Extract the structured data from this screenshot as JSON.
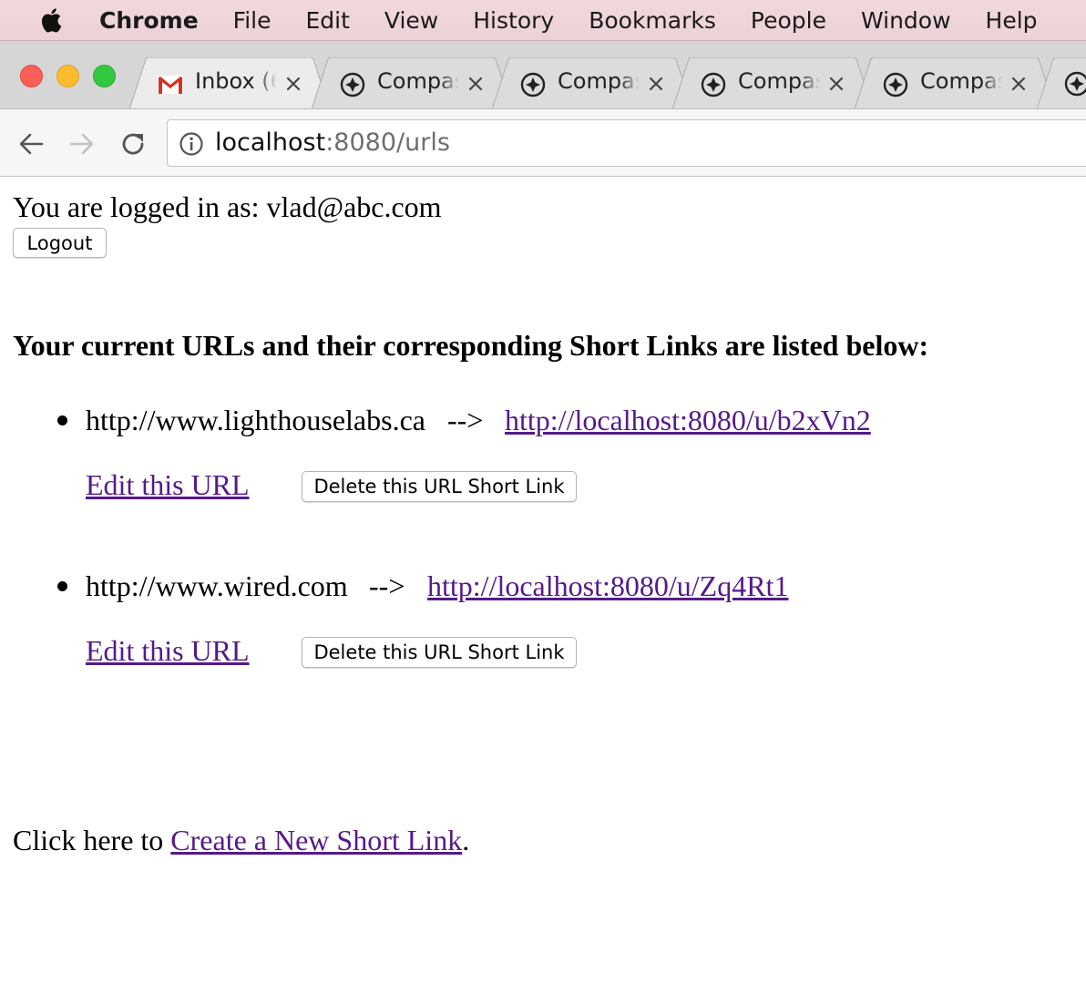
{
  "menubar": {
    "app_name": "Chrome",
    "items": [
      "File",
      "Edit",
      "View",
      "History",
      "Bookmarks",
      "People",
      "Window",
      "Help"
    ]
  },
  "tabs": [
    {
      "title": "Inbox (6",
      "icon": "gmail-icon"
    },
    {
      "title": "Compas",
      "icon": "compass-icon"
    },
    {
      "title": "Compas",
      "icon": "compass-icon"
    },
    {
      "title": "Compas",
      "icon": "compass-icon"
    },
    {
      "title": "Compas",
      "icon": "compass-icon"
    }
  ],
  "address_bar": {
    "host": "localhost",
    "rest": ":8080/urls"
  },
  "page": {
    "logged_in_text": "You are logged in as: vlad@abc.com",
    "logout_label": "Logout",
    "heading": "Your current URLs and their corresponding Short Links are listed below:",
    "arrow": "-->",
    "urls": [
      {
        "long_url": "http://www.lighthouselabs.ca",
        "short_url": "http://localhost:8080/u/b2xVn2",
        "edit_label": "Edit this URL",
        "delete_label": "Delete this URL Short Link"
      },
      {
        "long_url": "http://www.wired.com",
        "short_url": "http://localhost:8080/u/Zq4Rt1",
        "edit_label": "Edit this URL",
        "delete_label": "Delete this URL Short Link"
      }
    ],
    "footer_prefix": "Click here to ",
    "footer_link": "Create a New Short Link",
    "footer_suffix": "."
  },
  "colors": {
    "link": "#551a8b",
    "menubar": "#ecd2d6",
    "tabstrip": "#d6d6d6",
    "toolbar": "#f6f6f6"
  }
}
